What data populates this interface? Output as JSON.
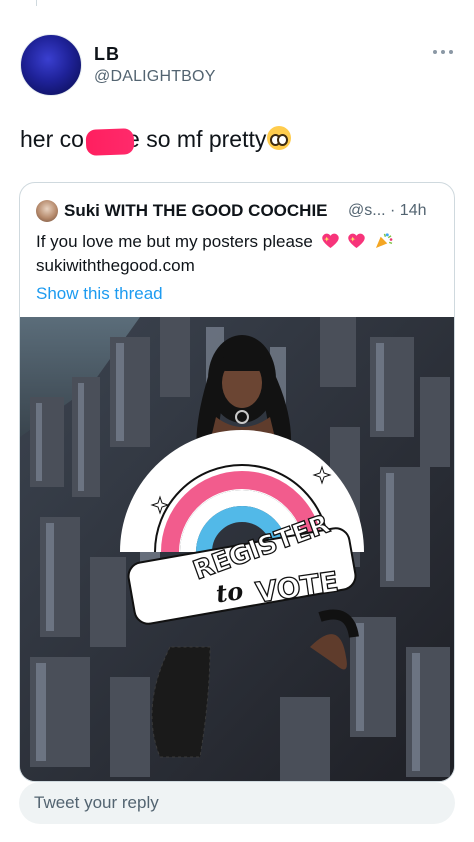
{
  "tweet": {
    "author": {
      "display_name": "LB",
      "handle": "@DALIGHTBOY"
    },
    "text_before": "her co",
    "text_after": "ie so mf pretty",
    "text_emoji": "pleading-face"
  },
  "quoted_tweet": {
    "author": {
      "display_name": "Suki WITH THE GOOD COOCHIE",
      "handle": "@s...",
      "time": "· 14h"
    },
    "line1": "If you love me but my posters please",
    "line1_emojis": [
      "sparkling-heart",
      "sparkling-heart",
      "party-popper"
    ],
    "line2": "sukiwiththegood.com",
    "show_thread_label": "Show this thread",
    "image": {
      "sticker_top": "REGISTER",
      "sticker_bottom_script": "to",
      "sticker_bottom": "VOTE"
    }
  },
  "reply": {
    "placeholder": "Tweet your reply"
  },
  "colors": {
    "link": "#1d9bf0",
    "secondary_text": "#536471",
    "redaction": "#ff2364"
  }
}
